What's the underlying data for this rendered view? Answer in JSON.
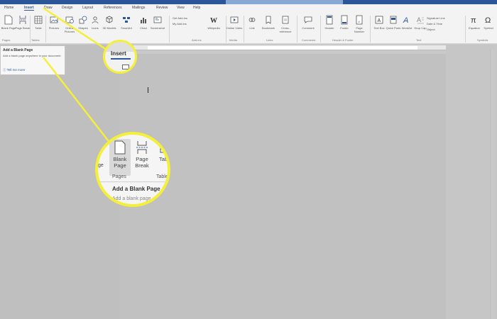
{
  "ribbon_tabs": [
    "Home",
    "Insert",
    "Draw",
    "Design",
    "Layout",
    "References",
    "Mailings",
    "Review",
    "View",
    "Help"
  ],
  "active_tab": "Insert",
  "ribbon_buttons": [
    {
      "label": "Blank Page"
    },
    {
      "label": "Page Break"
    },
    {
      "label": "Table"
    },
    {
      "label": "Pictures"
    },
    {
      "label": "Online Pictures"
    },
    {
      "label": "Shapes"
    },
    {
      "label": "Icons"
    },
    {
      "label": "3D Models"
    },
    {
      "label": "SmartArt"
    },
    {
      "label": "Chart"
    },
    {
      "label": "Screenshot"
    },
    {
      "label": "Wikipedia"
    },
    {
      "label": "Online Video"
    },
    {
      "label": "Link"
    },
    {
      "label": "Bookmark"
    },
    {
      "label": "Cross-reference"
    },
    {
      "label": "Comment"
    },
    {
      "label": "Header"
    },
    {
      "label": "Footer"
    },
    {
      "label": "Page Number"
    },
    {
      "label": "Text Box"
    },
    {
      "label": "Quick Parts"
    },
    {
      "label": "WordArt"
    },
    {
      "label": "Drop Cap"
    },
    {
      "label": "Equation"
    },
    {
      "label": "Symbol"
    }
  ],
  "addins": {
    "get": "Get Add-ins",
    "my": "My Add-ins"
  },
  "text_stack": {
    "signature": "Signature Line",
    "datetime": "Date & Time",
    "object": "Object"
  },
  "ribbon_groups": [
    "Pages",
    "Tables",
    "Add-ins",
    "Media",
    "Links",
    "Comments",
    "Header & Footer",
    "Text",
    "Symbols"
  ],
  "tooltip": {
    "title": "Add a Blank Page",
    "description": "Add a blank page anywhere in your document.",
    "tell_more": "Tell me more"
  },
  "zoom_insert": {
    "label": "Insert"
  },
  "zoom_pages": {
    "fragment": "ge",
    "blank_page": "Blank Page",
    "page_break": "Page Break",
    "table": "Table",
    "group_pages": "Pages",
    "group_table": "Table",
    "tooltip_title": "Add a Blank Page",
    "tooltip_desc": "Add a blank page"
  },
  "colors": {
    "callout": "#f3ef3a",
    "accent": "#2b579a"
  }
}
